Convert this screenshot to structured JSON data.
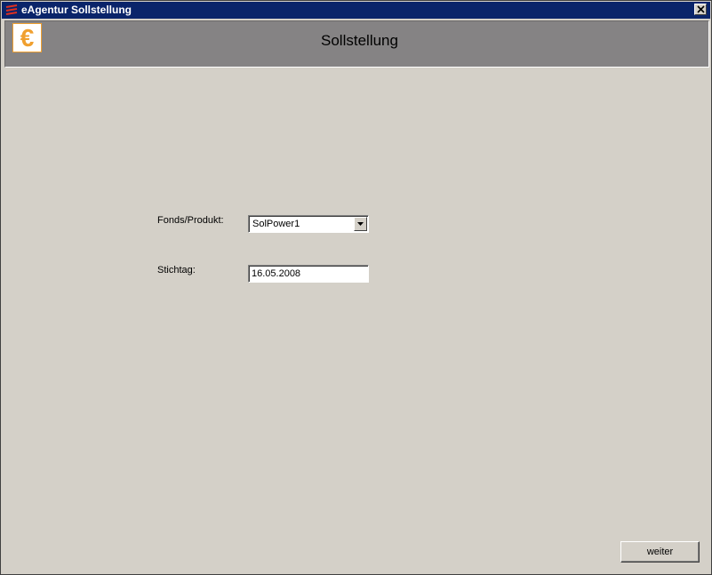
{
  "window": {
    "title": "eAgentur Sollstellung",
    "app_icon": "eagentur-lines-icon",
    "close_icon": "close-icon"
  },
  "header": {
    "title": "Sollstellung",
    "logo_icon": "euro-icon",
    "logo_glyph": "€",
    "logo_color": "#f0a030"
  },
  "form": {
    "fonds_label": "Fonds/Produkt:",
    "fonds_value": "SolPower1",
    "stichtag_label": "Stichtag:",
    "stichtag_value": "16.05.2008"
  },
  "actions": {
    "next_label": "weiter"
  },
  "colors": {
    "titlebar": "#0a246a",
    "header_bg": "#858384",
    "window_bg": "#d4d0c8"
  }
}
